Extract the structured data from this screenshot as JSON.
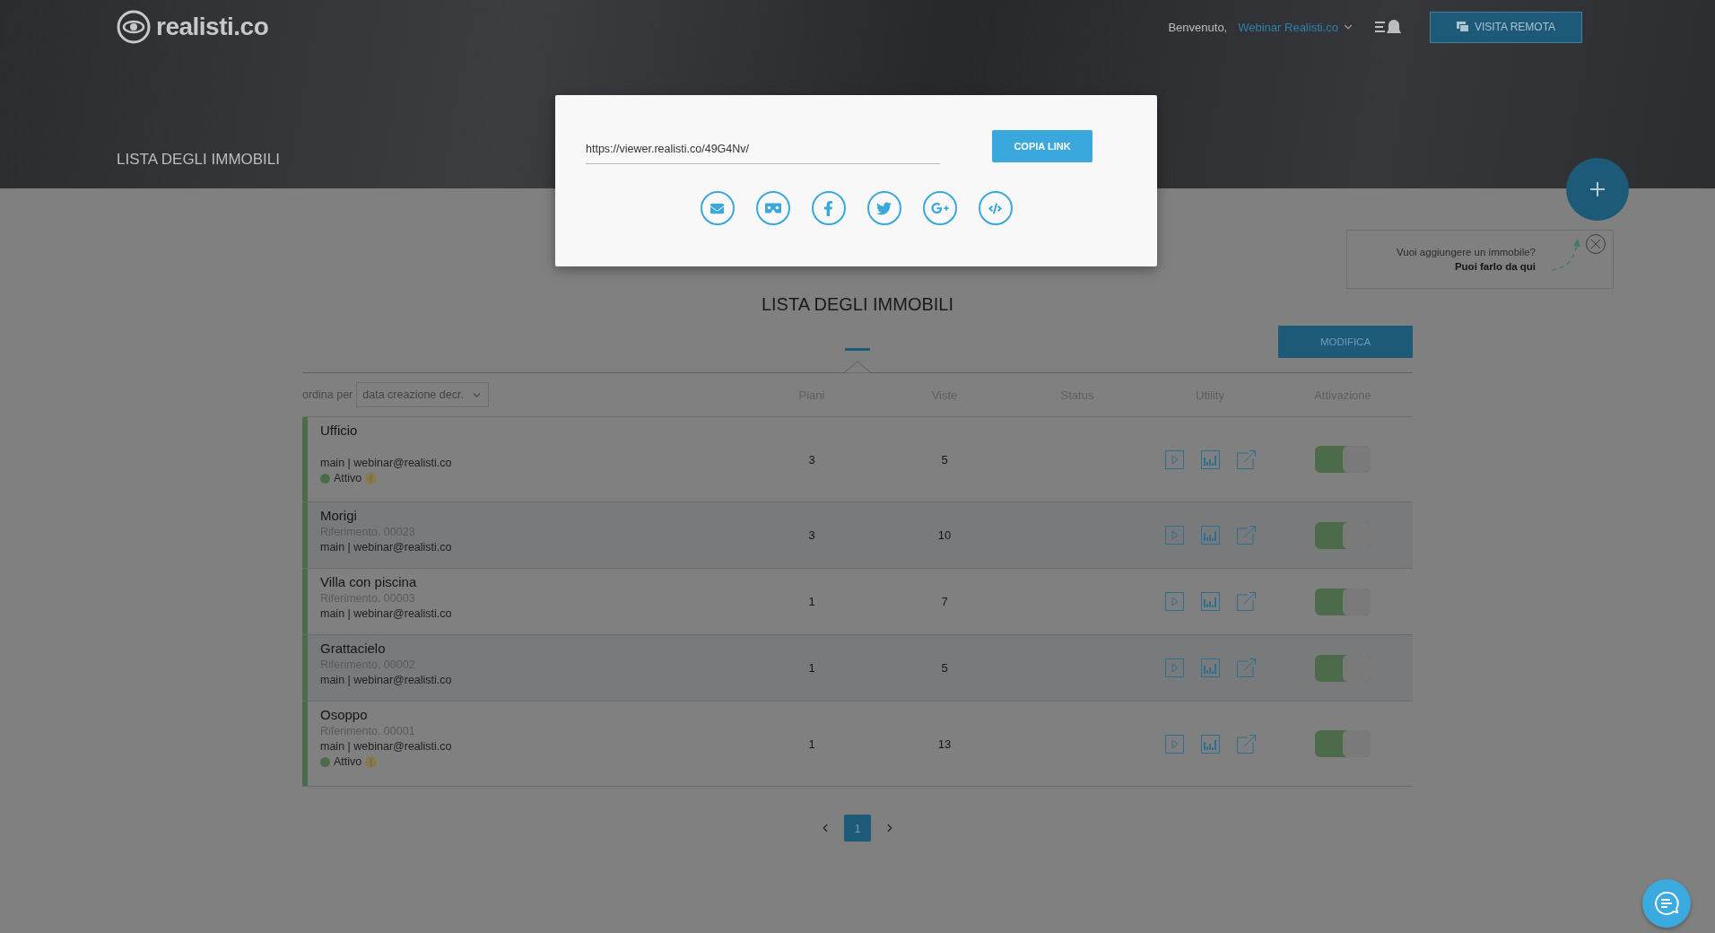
{
  "header": {
    "logo": "realisti.co",
    "greeting": "Benvenuto,",
    "user": "Webinar Realisti.co",
    "remote_button": "VISITA REMOTA",
    "banner_title": "LISTA DEGLI IMMOBILI"
  },
  "share_dialog": {
    "link": "https://viewer.realisti.co/49G4Nv/",
    "copy_button": "COPIA LINK",
    "share_options": [
      {
        "kind": "email"
      },
      {
        "kind": "vr"
      },
      {
        "kind": "facebook"
      },
      {
        "kind": "twitter"
      },
      {
        "kind": "googleplus"
      },
      {
        "kind": "embed"
      }
    ]
  },
  "add_tip": {
    "question": "Vuoi aggiungere un immobile?",
    "hint": "Puoi farlo da qui"
  },
  "list": {
    "title": "LISTA DEGLI IMMOBILI",
    "edit_button": "MODIFICA",
    "sort_label": "ordina per",
    "sort_value": "data creazione decr.",
    "columns": [
      "Piani",
      "Viste",
      "Status",
      "Utility",
      "Attivazione"
    ],
    "rows": [
      {
        "name": "Ufficio",
        "owner": "main | webinar@realisti.co",
        "status": "Attivo",
        "floors": "3",
        "views": "5",
        "active": true
      },
      {
        "name": "Morigi",
        "reference": "Riferimento. 00023",
        "owner": "main | webinar@realisti.co",
        "floors": "3",
        "views": "10",
        "active": true
      },
      {
        "name": "Villa con piscina",
        "reference": "Riferimento. 00003",
        "owner": "main | webinar@realisti.co",
        "floors": "1",
        "views": "7",
        "active": true
      },
      {
        "name": "Grattacielo",
        "reference": "Riferimento. 00002",
        "owner": "main | webinar@realisti.co",
        "floors": "1",
        "views": "5",
        "active": true
      },
      {
        "name": "Osoppo",
        "reference": "Riferimento. 00001",
        "owner": "main | webinar@realisti.co",
        "status": "Attivo",
        "floors": "1",
        "views": "13",
        "active": true
      }
    ]
  },
  "pagination": {
    "pages": [
      {
        "label": "1",
        "selected": true
      }
    ]
  }
}
